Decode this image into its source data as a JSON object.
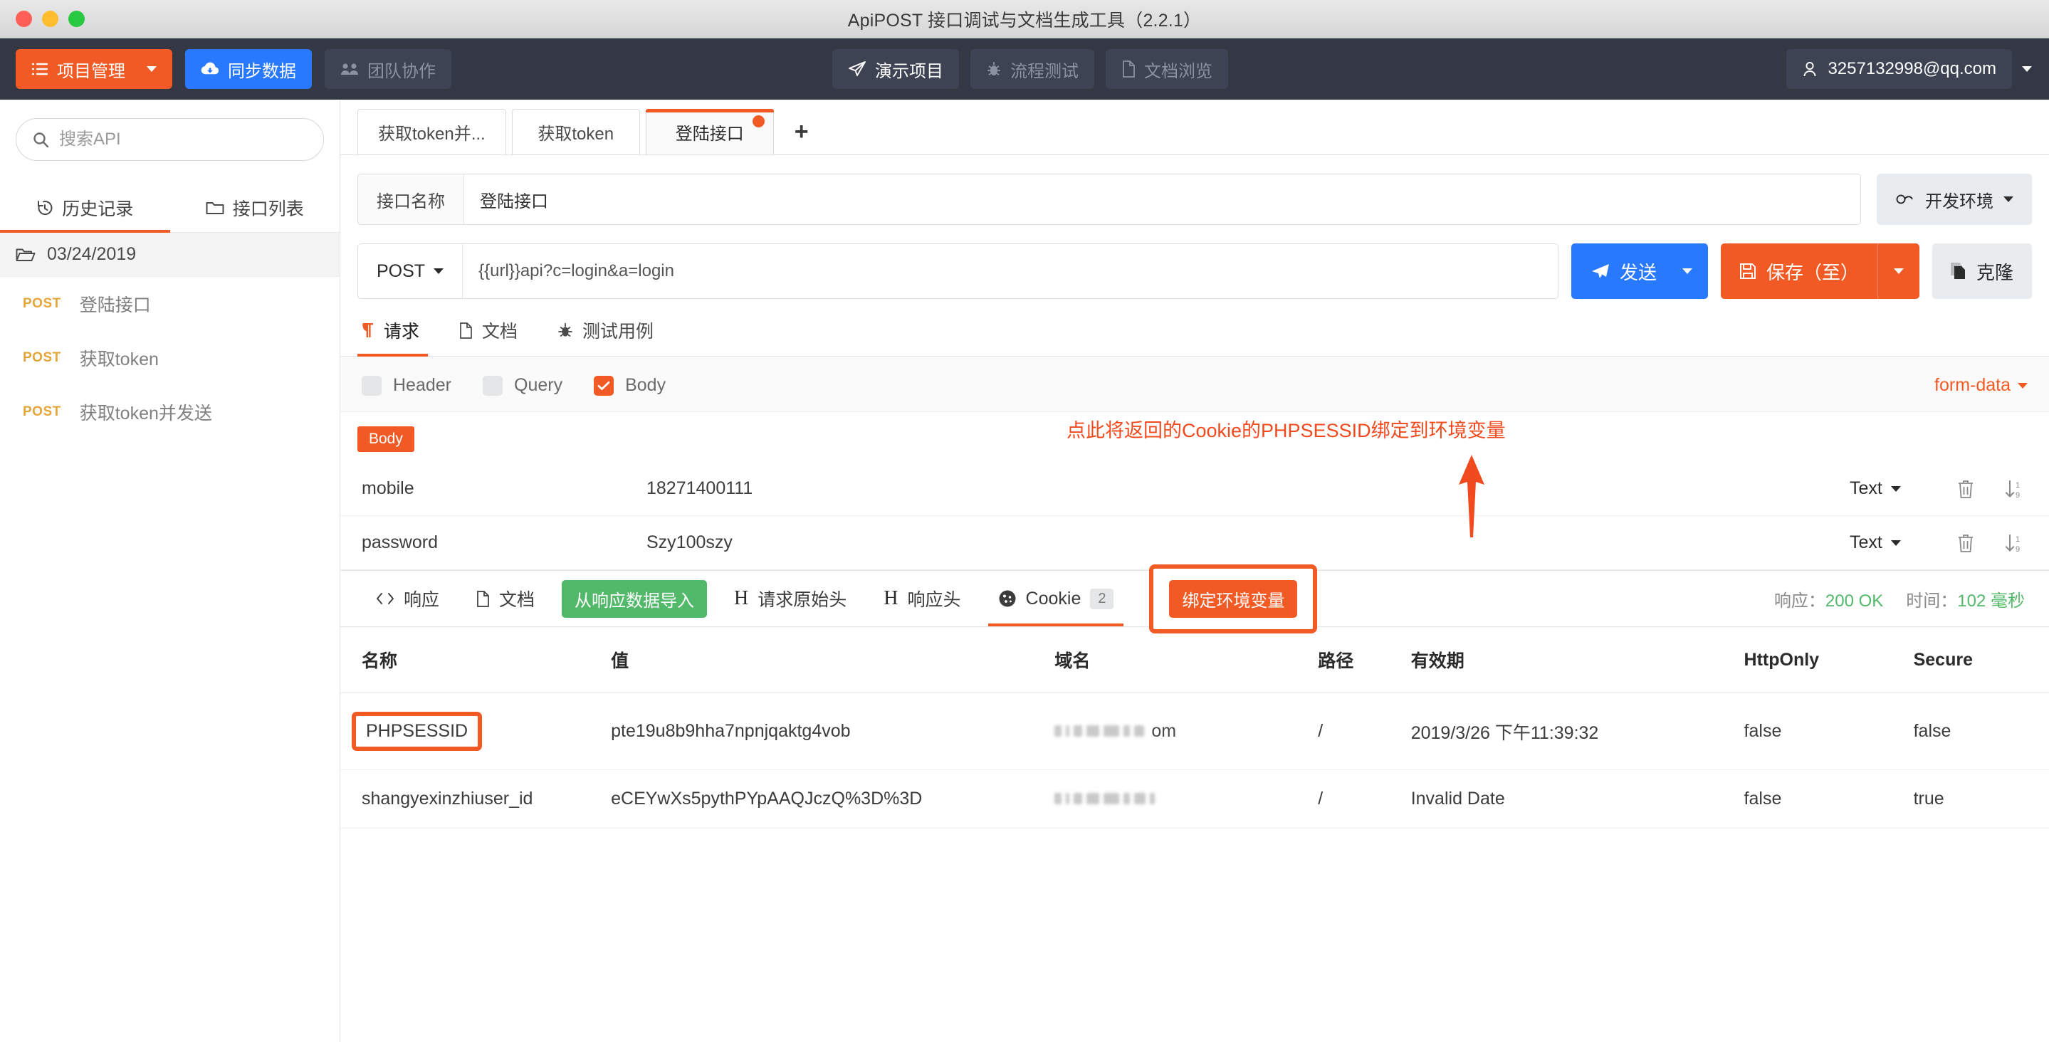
{
  "window": {
    "title": "ApiPOST 接口调试与文档生成工具（2.2.1）"
  },
  "topbar": {
    "project_manage": "项目管理",
    "sync_data": "同步数据",
    "team_collab": "团队协作",
    "demo_project": "演示项目",
    "flow_test": "流程测试",
    "doc_browse": "文档浏览",
    "account": "3257132998@qq.com",
    "accent_orange": "#f15a24",
    "accent_blue": "#2979ff",
    "bar_bg": "#333844"
  },
  "sidebar": {
    "search_placeholder": "搜索API",
    "search_value": "",
    "tabs": [
      {
        "label": "历史记录",
        "icon": "history-icon",
        "active": true
      },
      {
        "label": "接口列表",
        "icon": "folder-icon",
        "active": false
      }
    ],
    "folder": "03/24/2019",
    "items": [
      {
        "method": "POST",
        "name": "登陆接口"
      },
      {
        "method": "POST",
        "name": "获取token"
      },
      {
        "method": "POST",
        "name": "获取token并发送"
      }
    ]
  },
  "request_tabs": [
    {
      "label": "获取token并...",
      "active": false,
      "dirty": false
    },
    {
      "label": "获取token",
      "active": false,
      "dirty": false
    },
    {
      "label": "登陆接口",
      "active": true,
      "dirty": true
    }
  ],
  "add_tab_label": "+",
  "api": {
    "name_label": "接口名称",
    "name_value": "登陆接口",
    "env_label": "开发环境",
    "method": "POST",
    "url": "{{url}}api?c=login&a=login",
    "send_label": "发送",
    "save_label": "保存（至）",
    "clone_label": "克隆"
  },
  "request_tabs_sub": [
    {
      "label": "请求",
      "icon": "paragraph-icon",
      "active": true
    },
    {
      "label": "文档",
      "icon": "document-icon",
      "active": false
    },
    {
      "label": "测试用例",
      "icon": "bug-icon",
      "active": false
    }
  ],
  "param_types": [
    {
      "label": "Header",
      "checked": false
    },
    {
      "label": "Query",
      "checked": false
    },
    {
      "label": "Body",
      "checked": true
    }
  ],
  "body_format": "form-data",
  "body_badge": "Body",
  "body_params": [
    {
      "key": "mobile",
      "value": "18271400111",
      "type": "Text"
    },
    {
      "key": "password",
      "value": "Szy100szy",
      "type": "Text"
    }
  ],
  "annotation": {
    "text": "点此将返回的Cookie的PHPSESSID绑定到环境变量",
    "color": "#f04a1e"
  },
  "response_tabs": [
    {
      "label": "响应",
      "icon": "code-icon",
      "active": false
    },
    {
      "label": "文档",
      "icon": "document-icon",
      "active": false
    },
    {
      "label": "请求原始头",
      "icon": "header-h-icon",
      "active": false
    },
    {
      "label": "响应头",
      "icon": "header-h-icon",
      "active": false
    },
    {
      "label": "Cookie",
      "icon": "cookie-icon",
      "active": true,
      "count": "2"
    }
  ],
  "import_btn": "从响应数据导入",
  "bind_env_btn": "绑定环境变量",
  "response_meta": {
    "status_label": "响应：",
    "status_value": "200 OK",
    "time_label": "时间：",
    "time_value": "102 毫秒"
  },
  "cookie_table": {
    "columns": [
      "名称",
      "值",
      "域名",
      "路径",
      "有效期",
      "HttpOnly",
      "Secure"
    ],
    "rows": [
      {
        "name": "PHPSESSID",
        "value": "pte19u8b9hha7npnjqaktg4vob",
        "domain": "om",
        "path": "/",
        "expires": "2019/3/26 下午11:39:32",
        "httponly": "false",
        "secure": "false",
        "highlighted": true
      },
      {
        "name": "shangyexinzhiuser_id",
        "value": "eCEYwXs5pythPYpAAQJczQ%3D%3D",
        "domain": "",
        "path": "/",
        "expires": "Invalid Date",
        "httponly": "false",
        "secure": "true",
        "highlighted": false
      }
    ]
  }
}
